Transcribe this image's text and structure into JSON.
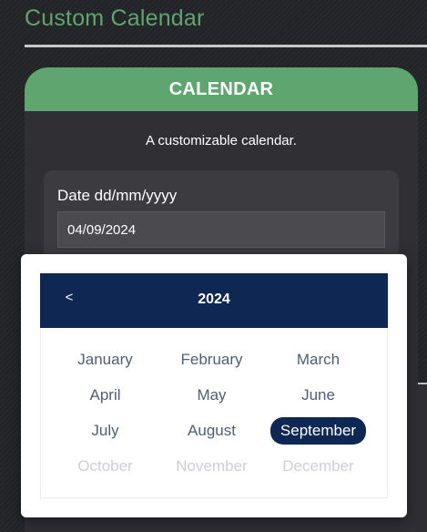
{
  "page": {
    "title": "Custom Calendar"
  },
  "calendar_card": {
    "header": "CALENDAR",
    "subtitle": "A customizable calendar."
  },
  "date_field": {
    "label": "Date dd/mm/yyyy",
    "value": "04/09/2024"
  },
  "picker": {
    "prev_label": "<",
    "year": "2024",
    "selected_month": "September",
    "months": [
      {
        "label": "January",
        "state": "enabled"
      },
      {
        "label": "February",
        "state": "enabled"
      },
      {
        "label": "March",
        "state": "enabled"
      },
      {
        "label": "April",
        "state": "enabled"
      },
      {
        "label": "May",
        "state": "enabled"
      },
      {
        "label": "June",
        "state": "enabled"
      },
      {
        "label": "July",
        "state": "enabled"
      },
      {
        "label": "August",
        "state": "enabled"
      },
      {
        "label": "September",
        "state": "selected"
      },
      {
        "label": "October",
        "state": "disabled"
      },
      {
        "label": "November",
        "state": "disabled"
      },
      {
        "label": "December",
        "state": "disabled"
      }
    ]
  },
  "colors": {
    "accent_green": "#5fa56f",
    "picker_navy": "#0e2753",
    "month_text": "#4e5f72",
    "month_disabled": "#c9d0d8"
  }
}
